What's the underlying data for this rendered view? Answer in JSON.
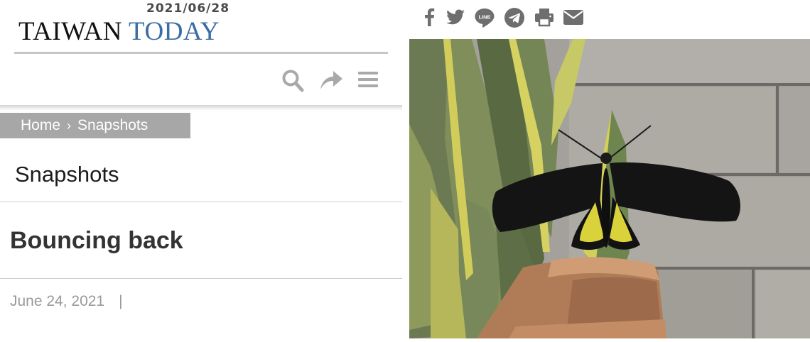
{
  "header": {
    "date": "2021/06/28",
    "logo_word1": "TAIWAN",
    "logo_word2": "TODAY",
    "logo_color_dark": "#111111",
    "logo_color_blue": "#3c6da3"
  },
  "toolbar": {
    "icons": [
      "search-icon",
      "share-icon",
      "menu-icon"
    ]
  },
  "breadcrumb": {
    "home": "Home",
    "separator": "›",
    "current": "Snapshots"
  },
  "section": {
    "title": "Snapshots"
  },
  "article": {
    "title": "Bouncing back",
    "date": "June 24, 2021",
    "date_separator": "|"
  },
  "share": {
    "icons": [
      "facebook-icon",
      "twitter-icon",
      "line-icon",
      "telegram-icon",
      "print-icon",
      "email-icon"
    ],
    "line_label": "LINE",
    "icon_color": "#6e6e6e"
  },
  "photo": {
    "subject": "black-and-yellow birdwing butterfly on snake plant"
  }
}
